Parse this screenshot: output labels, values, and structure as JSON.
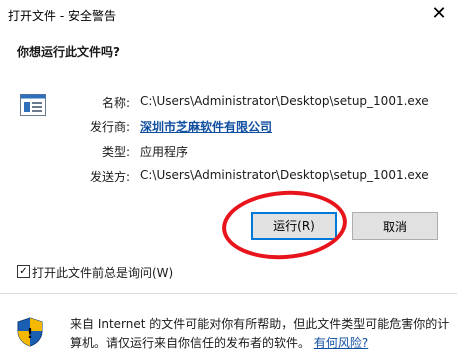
{
  "window": {
    "title": "打开文件 - 安全警告",
    "close_glyph": "✕"
  },
  "question": "你想运行此文件吗?",
  "file_icon": "application-file-icon",
  "fields": {
    "name_label": "名称:",
    "name_value": "C:\\Users\\Administrator\\Desktop\\setup_1001.exe",
    "publisher_label": "发行商:",
    "publisher_value": "深圳市芝麻软件有限公司",
    "type_label": "类型:",
    "type_value": "应用程序",
    "from_label": "发送方:",
    "from_value": "C:\\Users\\Administrator\\Desktop\\setup_1001.exe"
  },
  "buttons": {
    "run": "运行(R)",
    "cancel": "取消"
  },
  "checkbox": {
    "label": "打开此文件前总是询问(W)",
    "checked": true,
    "check_glyph": "✓"
  },
  "warning": {
    "text": "来自 Internet 的文件可能对你有所帮助，但此文件类型可能危害你的计算机。请仅运行来自你信任的发布者的软件。",
    "link": "有何风险?"
  },
  "colors": {
    "link": "#0f4ea0",
    "focus_border": "#0078d7",
    "annotation_circle": "#e8141c",
    "shield_blue": "#1a5fb4",
    "shield_yellow": "#f5b800"
  }
}
